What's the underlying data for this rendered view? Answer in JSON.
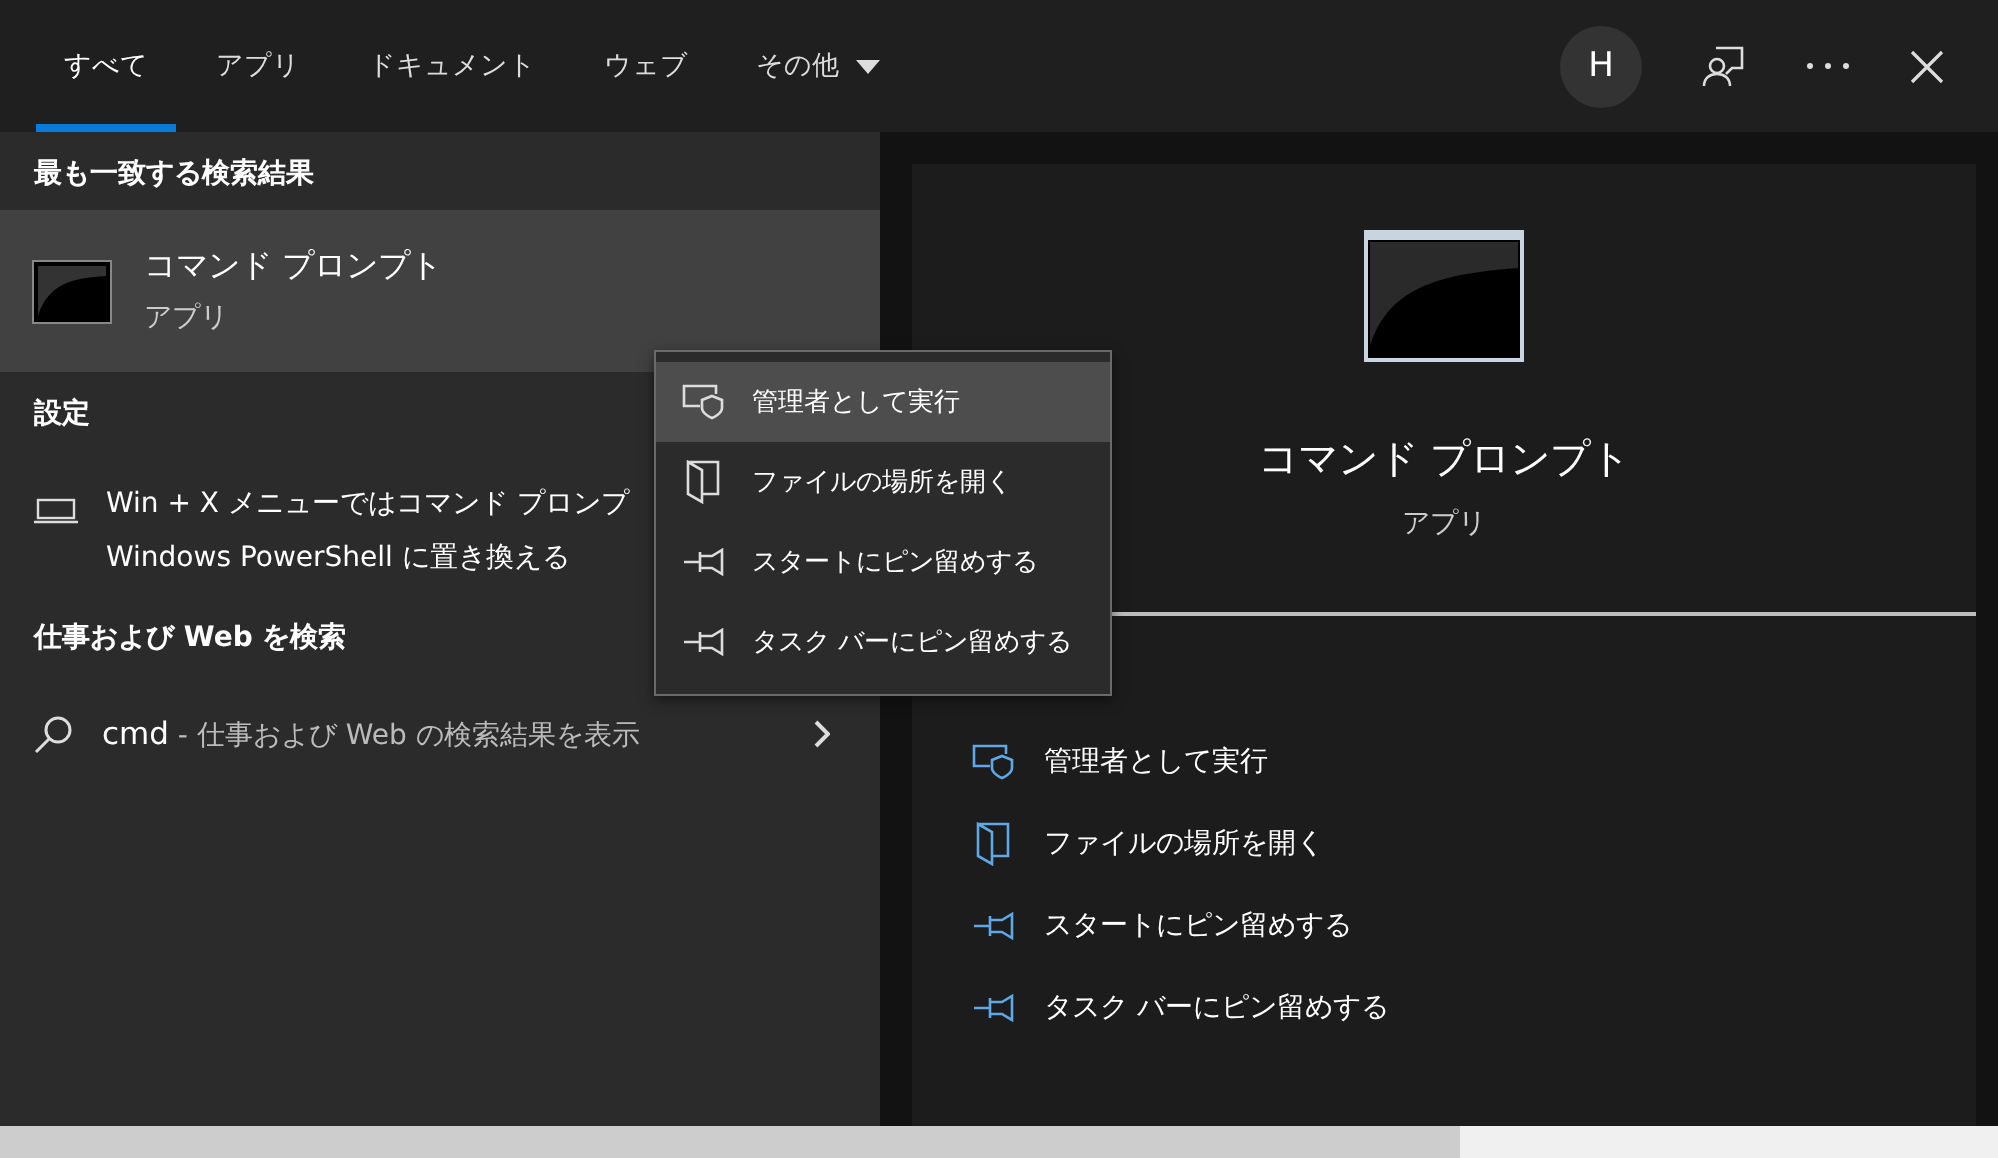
{
  "tabs": [
    {
      "label": "すべて",
      "selected": true,
      "dropdown": false
    },
    {
      "label": "アプリ",
      "selected": false,
      "dropdown": false
    },
    {
      "label": "ドキュメント",
      "selected": false,
      "dropdown": false
    },
    {
      "label": "ウェブ",
      "selected": false,
      "dropdown": false
    },
    {
      "label": "その他",
      "selected": false,
      "dropdown": true
    }
  ],
  "account_initial": "H",
  "best_match": {
    "heading": "最も一致する検索結果",
    "title": "コマンド プロンプト",
    "subtitle": "アプリ",
    "selected": true
  },
  "settings": {
    "heading": "設定",
    "lines": [
      "Win + X メニューではコマンド プロンプ",
      "Windows PowerShell に置き換える"
    ]
  },
  "web_search": {
    "heading": "仕事および Web を検索",
    "query": "cmd",
    "hint": " - 仕事および Web の検索結果を表示"
  },
  "preview": {
    "title": "コマンド プロンプト",
    "subtitle": "アプリ",
    "actions": [
      {
        "kind": "shield",
        "label": "管理者として実行"
      },
      {
        "kind": "folder",
        "label": "ファイルの場所を開く"
      },
      {
        "kind": "pin",
        "label": "スタートにピン留めする"
      },
      {
        "kind": "pin",
        "label": "タスク バーにピン留めする"
      }
    ]
  },
  "context_menu": [
    {
      "kind": "shield",
      "label": "管理者として実行",
      "selected": true
    },
    {
      "kind": "folder",
      "label": "ファイルの場所を開く",
      "selected": false
    },
    {
      "kind": "pin",
      "label": "スタートにピン留めする",
      "selected": false
    },
    {
      "kind": "pin",
      "label": "タスク バーにピン留めする",
      "selected": false
    }
  ]
}
